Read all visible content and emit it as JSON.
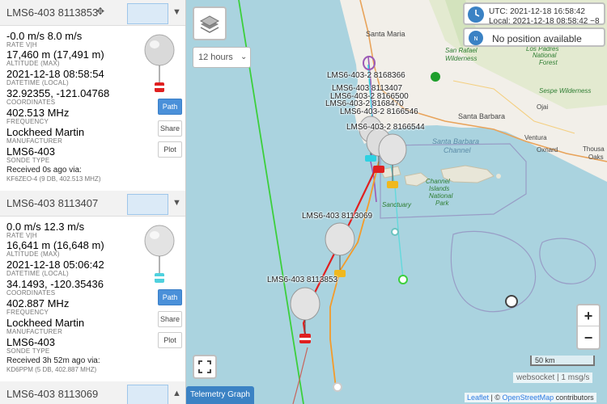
{
  "sidebar": {
    "cards": [
      {
        "name": "LMS6-403 8113853",
        "gps_icon": "crosshair-icon",
        "toggle_icon": "triangle-down",
        "rate": "-0.0 m/s 8.0 m/s",
        "rate_label": "RATE V|H",
        "altitude": "17,460 m (17,491 m)",
        "altitude_label": "ALTITUDE (MAX)",
        "datetime": "2021-12-18 08:58:54",
        "datetime_label": "DATETIME (LOCAL)",
        "coords": "32.92355, -121.04768",
        "coords_label": "COORDINATES",
        "freq": "402.513 MHz",
        "freq_label": "FREQUENCY",
        "manufacturer": "Lockheed Martin",
        "manufacturer_label": "MANUFACTURER",
        "sonde_type": "LMS6-403",
        "sonde_type_label": "SONDE TYPE",
        "received": "Received 0s ago via:",
        "received_via": "KF6ZEO-4 (9 DB, 402.513 MHZ)",
        "buttons": [
          "Path",
          "Share",
          "Plot"
        ],
        "balloon_color": "#d9d9d9",
        "payload_color": "#e02020"
      },
      {
        "name": "LMS6-403 8113407",
        "toggle_icon": "triangle-down",
        "rate": "0.0 m/s 12.3 m/s",
        "rate_label": "RATE V|H",
        "altitude": "16,641 m (16,648 m)",
        "altitude_label": "ALTITUDE (MAX)",
        "datetime": "2021-12-18 05:06:42",
        "datetime_label": "DATETIME (LOCAL)",
        "coords": "34.1493, -120.35436",
        "coords_label": "COORDINATES",
        "freq": "402.887 MHz",
        "freq_label": "FREQUENCY",
        "manufacturer": "Lockheed Martin",
        "manufacturer_label": "MANUFACTURER",
        "sonde_type": "LMS6-403",
        "sonde_type_label": "SONDE TYPE",
        "received": "Received 3h 52m ago via:",
        "received_via": "KD6PPM (5 DB, 402.887 MHZ)",
        "buttons": [
          "Path",
          "Share",
          "Plot"
        ],
        "balloon_color": "#e3e3e3",
        "payload_color": "#4fd1de"
      },
      {
        "name": "LMS6-403 8113069",
        "toggle_icon": "triangle-up"
      }
    ]
  },
  "map": {
    "time_select": "12 hours",
    "clock": {
      "utc": "UTC: 2021-12-18 16:58:42",
      "local": "Local: 2021-12-18 08:58:42 −8"
    },
    "position_status": "No position available",
    "zoom_in": "+",
    "zoom_out": "−",
    "scale": "50 km",
    "status": "websocket | 1 msg/s",
    "attribution_leaflet": "Leaflet",
    "attribution_sep": "| ©",
    "attribution_osm": "OpenStreetMap",
    "attribution_tail": "contributors",
    "telemetry_button": "Telemetry Graph",
    "fullscreen_icon": "fullscreen-icon",
    "layers_icon": "layers-icon",
    "sonde_labels": [
      "LMS6-403-2 8168366",
      "LMS6-403 8113407",
      "LMS6-403-2 8166500",
      "LMS6-403-2 8168470",
      "LMS6-403-2 8166546",
      "LMS6-403-2 8166544",
      "LMS6-403 8113069",
      "LMS6-403 8113853"
    ],
    "places": {
      "santa_maria": "Santa Maria",
      "santa_barbara": "Santa Barbara",
      "channel_1": "Santa Barbara",
      "channel_2": "Channel",
      "oxnard": "Oxnard",
      "thousand_oaks": "Thousa",
      "thousand_oaks_2": "Oaks",
      "ventura": "Ventura",
      "ojai": "Ojai",
      "san_rafael": "San Rafael",
      "wilderness": "Wilderness",
      "los_padres": "Los Padres",
      "national": "National",
      "forest": "Forest",
      "sespe": "Sespe Wilderness",
      "channel_islands": "Channel",
      "islands": "Islands",
      "nat_park": "National",
      "park": "Park",
      "sanctuary": "Sanctuary"
    }
  }
}
